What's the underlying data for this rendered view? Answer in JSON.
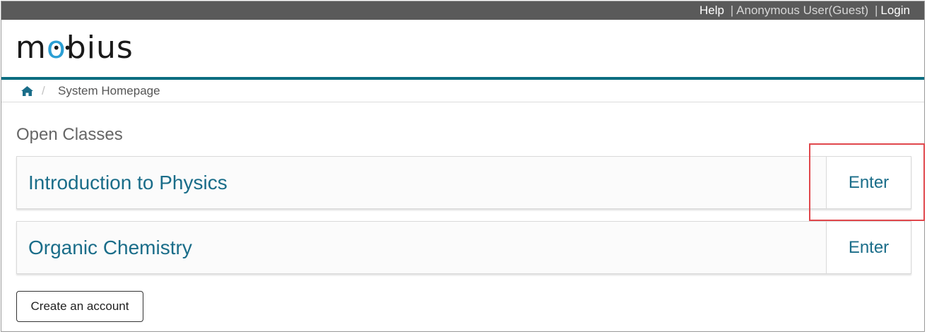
{
  "topbar": {
    "help": "Help",
    "separator": "|",
    "user": "Anonymous User(Guest)",
    "login": "Login"
  },
  "logo": {
    "text_left": "m",
    "text_o": "o",
    "text_right": "bius",
    "dots": "••"
  },
  "breadcrumb": {
    "home_icon": "home-icon",
    "separator": "/",
    "current": "System Homepage"
  },
  "main": {
    "section_title": "Open Classes",
    "classes": [
      {
        "name": "Introduction to Physics",
        "action": "Enter"
      },
      {
        "name": "Organic Chemistry",
        "action": "Enter"
      }
    ],
    "create_account": "Create an account"
  },
  "colors": {
    "topbar": "#5a5a5a",
    "accent_rule": "#0a6d80",
    "link": "#1a6d89",
    "highlight": "#e0474c",
    "logo_o": "#2b9fd4"
  }
}
